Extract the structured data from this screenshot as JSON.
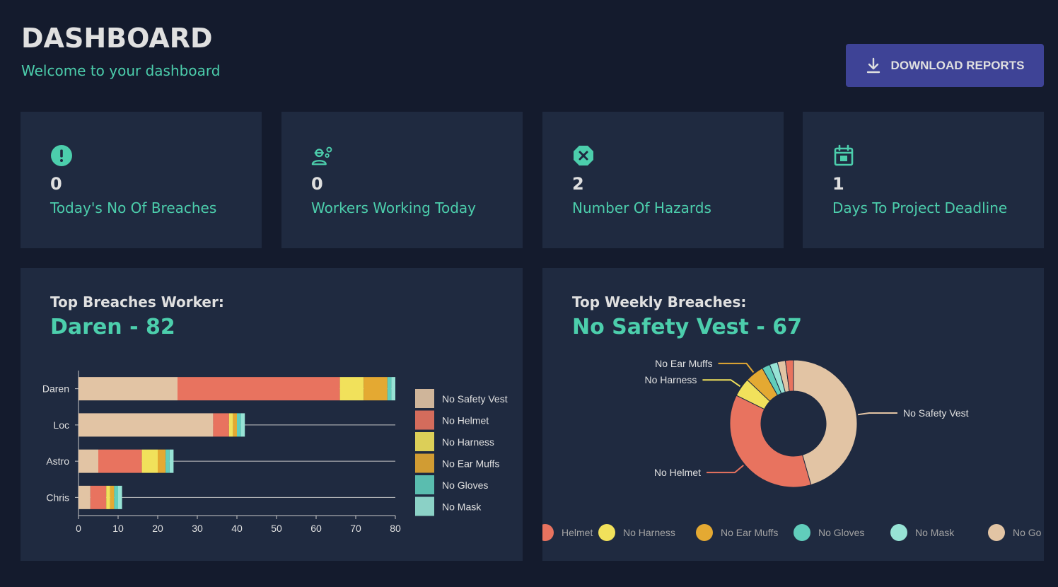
{
  "header": {
    "title": "DASHBOARD",
    "subtitle": "Welcome to your dashboard",
    "download_label": "DOWNLOAD REPORTS"
  },
  "stats": [
    {
      "icon": "error-icon",
      "value": "0",
      "label": "Today's No Of Breaches"
    },
    {
      "icon": "engineering-icon",
      "value": "0",
      "label": "Workers Working Today"
    },
    {
      "icon": "cancel-icon",
      "value": "2",
      "label": "Number Of Hazards"
    },
    {
      "icon": "calendar-icon",
      "value": "1",
      "label": "Days To Project Deadline"
    }
  ],
  "colors": {
    "background": "#141b2d",
    "panel": "#1f2a40",
    "accent": "#4cceac",
    "button": "#3e4396"
  },
  "worker_panel": {
    "title": "Top Breaches Worker:",
    "value": "Daren - 82"
  },
  "weekly_panel": {
    "title": "Top Weekly Breaches:",
    "value": "No Safety Vest - 67"
  },
  "chart_data": [
    {
      "type": "bar",
      "orientation": "horizontal",
      "stacked": true,
      "categories": [
        "Daren",
        "Loc",
        "Astro",
        "Chris"
      ],
      "series": [
        {
          "name": "No Safety Vest",
          "color": "#e2c4a4",
          "values": [
            25,
            34,
            5,
            3
          ]
        },
        {
          "name": "No Helmet",
          "color": "#e8735f",
          "values": [
            41,
            4,
            11,
            4
          ]
        },
        {
          "name": "No Harness",
          "color": "#f1e15b",
          "values": [
            6,
            1,
            4,
            1
          ]
        },
        {
          "name": "No Ear Muffs",
          "color": "#e4a932",
          "values": [
            6,
            1,
            2,
            1
          ]
        },
        {
          "name": "No Gloves",
          "color": "#61cdbb",
          "values": [
            1,
            1,
            1,
            1
          ]
        },
        {
          "name": "No Mask",
          "color": "#97e3d5",
          "values": [
            1,
            1,
            1,
            1
          ]
        }
      ],
      "xlim": [
        0,
        80
      ],
      "xticks": [
        "0",
        "10",
        "20",
        "30",
        "40",
        "50",
        "60",
        "70",
        "80"
      ],
      "legend": [
        "No Safety Vest",
        "No Helmet",
        "No Harness",
        "No Ear Muffs",
        "No Gloves",
        "No Mask"
      ],
      "legend_position": "right"
    },
    {
      "type": "pie",
      "donut": true,
      "slices": [
        {
          "name": "No Safety Vest",
          "value": 67,
          "color": "#e2c4a4"
        },
        {
          "name": "No Helmet",
          "value": 54,
          "color": "#e8735f"
        },
        {
          "name": "No Harness",
          "value": 7,
          "color": "#f1e15b"
        },
        {
          "name": "No Ear Muffs",
          "value": 7,
          "color": "#e4a932"
        },
        {
          "name": "No Gloves",
          "value": 3,
          "color": "#61cdbb"
        },
        {
          "name": "No Mask",
          "value": 3,
          "color": "#97e3d5"
        },
        {
          "name": "",
          "value": 3,
          "color": "#e2c4a4"
        },
        {
          "name": "",
          "value": 3,
          "color": "#e8735f"
        }
      ],
      "slice_labels": [
        "No Safety Vest",
        "No Helmet",
        "No Harness",
        "No Ear Muffs"
      ],
      "legend": [
        {
          "name": "Helmet",
          "color": "#e8735f"
        },
        {
          "name": "No Harness",
          "color": "#f1e15b"
        },
        {
          "name": "No Ear Muffs",
          "color": "#e4a932"
        },
        {
          "name": "No Gloves",
          "color": "#61cdbb"
        },
        {
          "name": "No Mask",
          "color": "#97e3d5"
        },
        {
          "name": "No Go",
          "color": "#e2c4a4"
        }
      ],
      "legend_position": "bottom"
    }
  ]
}
